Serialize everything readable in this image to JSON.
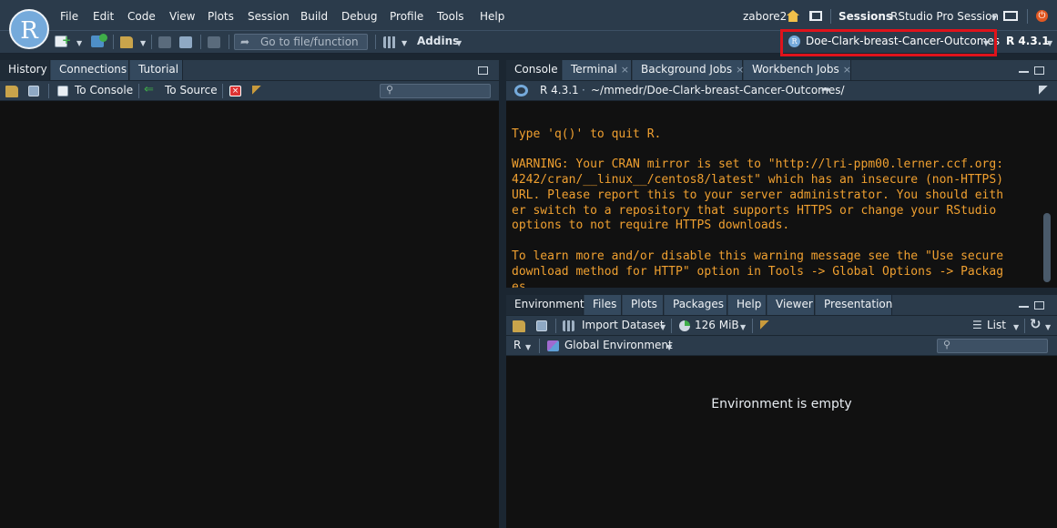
{
  "logo": {
    "letter": "R"
  },
  "menu": [
    "File",
    "Edit",
    "Code",
    "View",
    "Plots",
    "Session",
    "Build",
    "Debug",
    "Profile",
    "Tools",
    "Help"
  ],
  "header_right": {
    "user": "zabore2",
    "sessions_label": "Sessions",
    "session_name": "RStudio Pro Session"
  },
  "toolbar": {
    "goto_placeholder": "Go to file/function",
    "addins_label": "Addins",
    "project_name": "Doe-Clark-breast-Cancer-Outcomes",
    "r_version": "R 4.3.1"
  },
  "left_pane": {
    "tabs": [
      "History",
      "Connections",
      "Tutorial"
    ],
    "to_console": "To Console",
    "to_source": "To Source"
  },
  "console_pane": {
    "tabs": [
      "Console",
      "Terminal",
      "Background Jobs",
      "Workbench Jobs"
    ],
    "r_version": "R 4.3.1",
    "path": "~/mmedr/Doe-Clark-breast-Cancer-Outcomes/",
    "lines": [
      "Type 'q()' to quit R.",
      "",
      "WARNING: Your CRAN mirror is set to \"http://lri-ppm00.lerner.ccf.org:",
      "4242/cran/__linux__/centos8/latest\" which has an insecure (non-HTTPS)",
      "URL. Please report this to your server administrator. You should eith",
      "er switch to a repository that supports HTTPS or change your RStudio",
      "options to not require HTTPS downloads.",
      "",
      "To learn more and/or disable this warning message see the \"Use secure",
      "download method for HTTP\" option in Tools -> Global Options -> Packag",
      "es."
    ],
    "prompt": ">"
  },
  "env_pane": {
    "tabs": [
      "Environment",
      "Files",
      "Plots",
      "Packages",
      "Help",
      "Viewer",
      "Presentation"
    ],
    "import_dataset": "Import Dataset",
    "memory": "126 MiB",
    "list_label": "List",
    "r_label": "R",
    "global_env": "Global Environment",
    "empty_message": "Environment is empty"
  }
}
